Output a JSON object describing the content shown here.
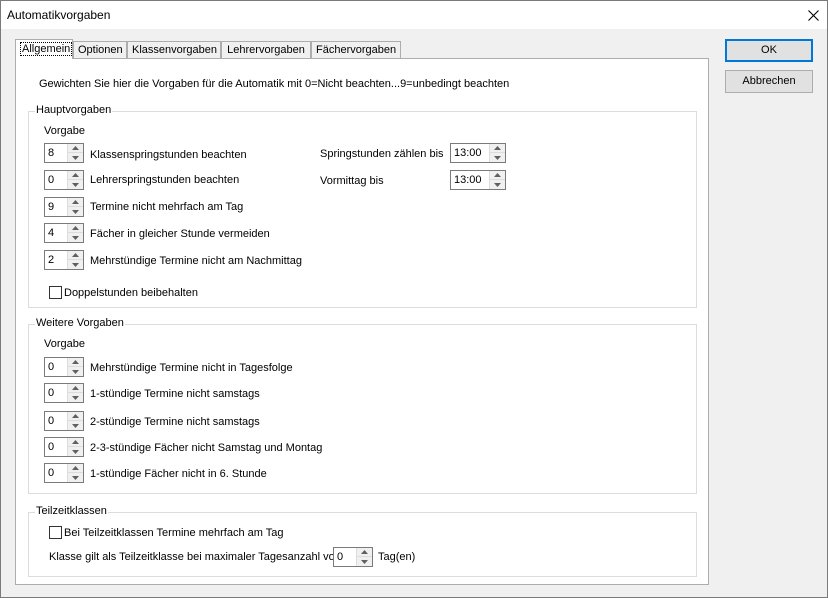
{
  "window": {
    "title": "Automatikvorgaben"
  },
  "tabs": [
    {
      "label": "Allgemein",
      "active": true
    },
    {
      "label": "Optionen",
      "active": false
    },
    {
      "label": "Klassenvorgaben",
      "active": false
    },
    {
      "label": "Lehrervorgaben",
      "active": false
    },
    {
      "label": "Fächervorgaben",
      "active": false
    }
  ],
  "buttons": {
    "ok": "OK",
    "cancel": "Abbrechen"
  },
  "intro": "Gewichten Sie hier die Vorgaben für die Automatik mit 0=Nicht beachten...9=unbedingt beachten",
  "haupt": {
    "title": "Hauptvorgaben",
    "column": "Vorgabe",
    "rows": [
      {
        "value": "8",
        "label": "Klassenspringstunden beachten"
      },
      {
        "value": "0",
        "label": "Lehrerspringstunden beachten"
      },
      {
        "value": "9",
        "label": "Termine nicht mehrfach am Tag"
      },
      {
        "value": "4",
        "label": "Fächer in gleicher Stunde vermeiden"
      },
      {
        "value": "2",
        "label": "Mehrstündige Termine nicht am Nachmittag"
      }
    ],
    "springstunden_label": "Springstunden zählen bis",
    "springstunden_value": "13:00",
    "vormittag_label": "Vormittag bis",
    "vormittag_value": "13:00",
    "doppel_label": "Doppelstunden beibehalten",
    "doppel_checked": false
  },
  "weitere": {
    "title": "Weitere Vorgaben",
    "column": "Vorgabe",
    "rows": [
      {
        "value": "0",
        "label": "Mehrstündige Termine nicht in Tagesfolge"
      },
      {
        "value": "0",
        "label": "1-stündige Termine nicht samstags"
      },
      {
        "value": "0",
        "label": "2-stündige Termine nicht samstags"
      },
      {
        "value": "0",
        "label": "2-3-stündige Fächer nicht Samstag und Montag"
      },
      {
        "value": "0",
        "label": "1-stündige Fächer nicht in 6. Stunde"
      }
    ]
  },
  "teilzeit": {
    "title": "Teilzeitklassen",
    "mehrfach_label": "Bei Teilzeitklassen Termine mehrfach am Tag",
    "mehrfach_checked": false,
    "max_label": "Klasse gilt als Teilzeitklasse bei maximaler Tagesanzahl von",
    "max_value": "0",
    "unit": "Tag(en)"
  },
  "icons": {
    "close": "close-icon",
    "spin_up": "arrow-up-icon",
    "spin_down": "arrow-down-icon"
  }
}
